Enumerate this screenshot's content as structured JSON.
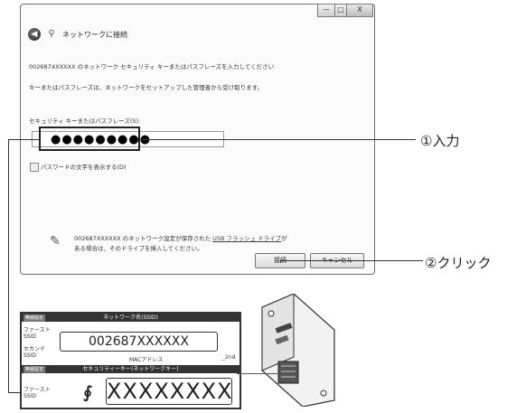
{
  "window": {
    "title": "ネットワークに接続",
    "controls": [
      "—",
      "□",
      "X"
    ],
    "line1": "002687XXXXXX のネットワーク セキュリティ キーまたはパスフレーズを入力してください",
    "line2": "キーまたはパスフレーズは、ネットワークをセットアップした管理者から受け取ります。",
    "field_label": "セキュリティ キーまたはパスフレーズ(S):",
    "password_value": "●●●●●●●●●",
    "show_chars_label": "パスワードの文字を表示する(D)",
    "usb_line1_pre": "002687XXXXXX のネットワーク設定が保存された ",
    "usb_link": "USB フラッシュ ドライブ",
    "usb_line1_post": "が",
    "usb_line2": "ある場合は、そのドライブを挿入してください。",
    "connect_label": "接続",
    "cancel_label": "キャンセル"
  },
  "callouts": {
    "step1": "①入力",
    "step2": "②クリック"
  },
  "sticker": {
    "wireless_tag": "無線設定",
    "network_name_header": "ネットワーク名(SSID)",
    "first_ssid": "ファースト\nSSID",
    "second_ssid": "セカンド\nSSID",
    "ssid_value": "002687XXXXXX",
    "mac_label": "MACアドレス",
    "second_suffix": "_2nd",
    "wireless_tag2": "無線設定",
    "security_key_header": "セキュリティーキー(ネットワークキー)",
    "first_ssid2": "ファースト\nSSID",
    "key_value": "XXXXXXXX"
  }
}
